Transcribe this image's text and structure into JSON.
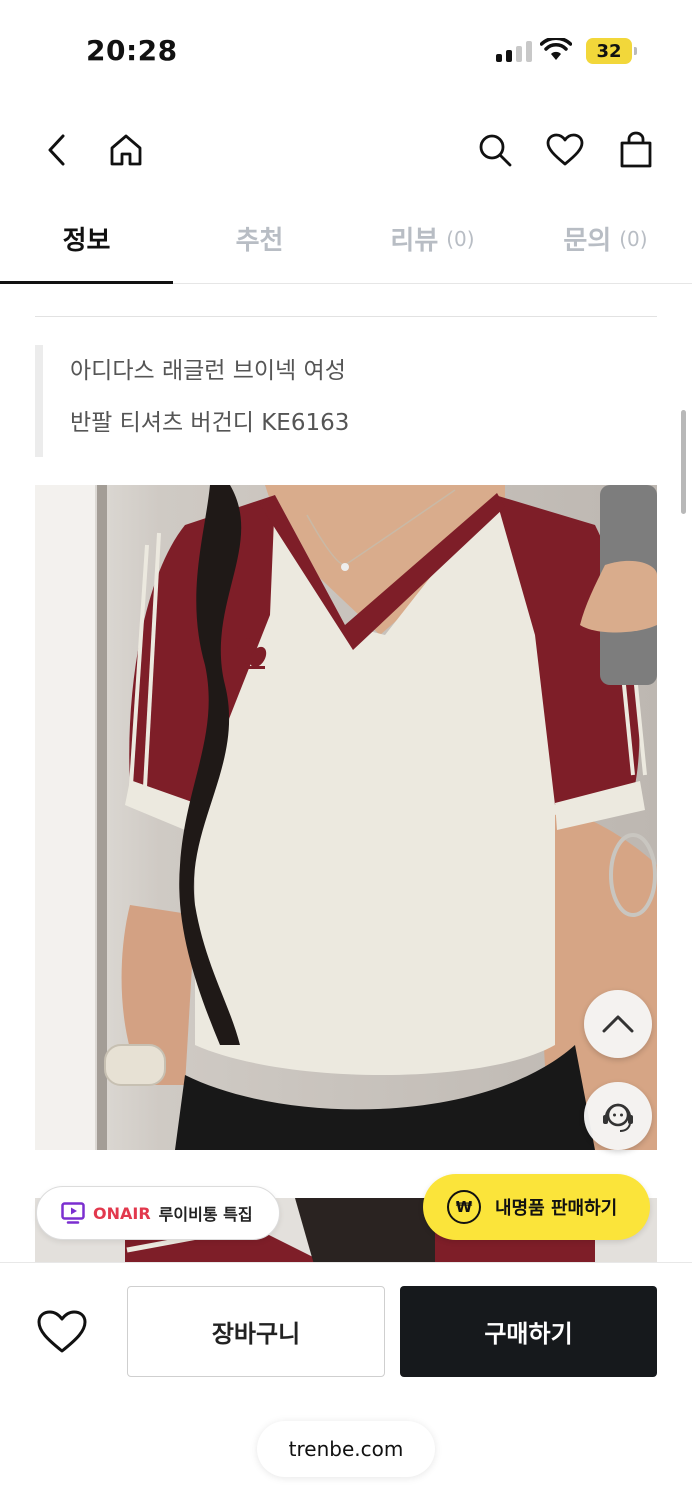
{
  "status_bar": {
    "time": "20:28",
    "battery": "32"
  },
  "tabs": [
    {
      "label": "정보",
      "count": ""
    },
    {
      "label": "추천",
      "count": ""
    },
    {
      "label": "리뷰",
      "count": "(0)"
    },
    {
      "label": "문의",
      "count": "(0)"
    }
  ],
  "product": {
    "title_line1": "아디다스 래글런 브이넥 여성",
    "title_line2": "반팔 티셔츠 버건디 KE6163"
  },
  "onair": {
    "tag": "ONAIR",
    "text": "루이비통 특집"
  },
  "sell_button": {
    "coin": "₩",
    "label": "내명품 판매하기"
  },
  "bottom_bar": {
    "cart_label": "장바구니",
    "buy_label": "구매하기",
    "url": "trenbe.com"
  },
  "colors": {
    "accent_yellow": "#fbe43a",
    "buy_dark": "#16191c",
    "onair_red": "#e2384d",
    "jersey_burgundy": "#7e1e28"
  }
}
